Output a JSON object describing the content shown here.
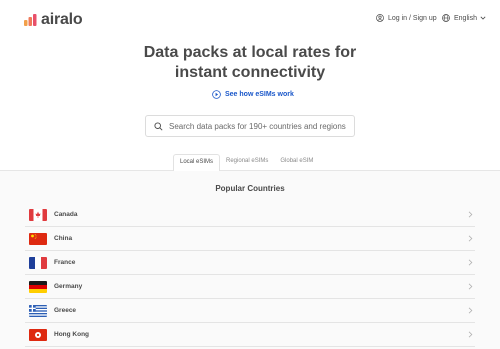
{
  "header": {
    "brand": "airalo",
    "login_label": "Log in / Sign up",
    "language_label": "English",
    "accent_color": "#f06060"
  },
  "hero": {
    "title_line1": "Data packs at local rates for",
    "title_line2": "instant connectivity",
    "see_how_label": "See how eSIMs work",
    "link_color": "#1a57c9"
  },
  "search": {
    "placeholder": "Search data packs for 190+ countries and regions",
    "value": ""
  },
  "tabs": [
    {
      "label": "Local eSIMs",
      "active": true
    },
    {
      "label": "Regional eSIMs",
      "active": false
    },
    {
      "label": "Global eSIM",
      "active": false
    }
  ],
  "popular": {
    "title": "Popular Countries",
    "countries": [
      {
        "name": "Canada",
        "flag_icon": "canada-flag-icon"
      },
      {
        "name": "China",
        "flag_icon": "china-flag-icon"
      },
      {
        "name": "France",
        "flag_icon": "france-flag-icon"
      },
      {
        "name": "Germany",
        "flag_icon": "germany-flag-icon"
      },
      {
        "name": "Greece",
        "flag_icon": "greece-flag-icon"
      },
      {
        "name": "Hong Kong",
        "flag_icon": "hong-kong-flag-icon"
      }
    ]
  }
}
